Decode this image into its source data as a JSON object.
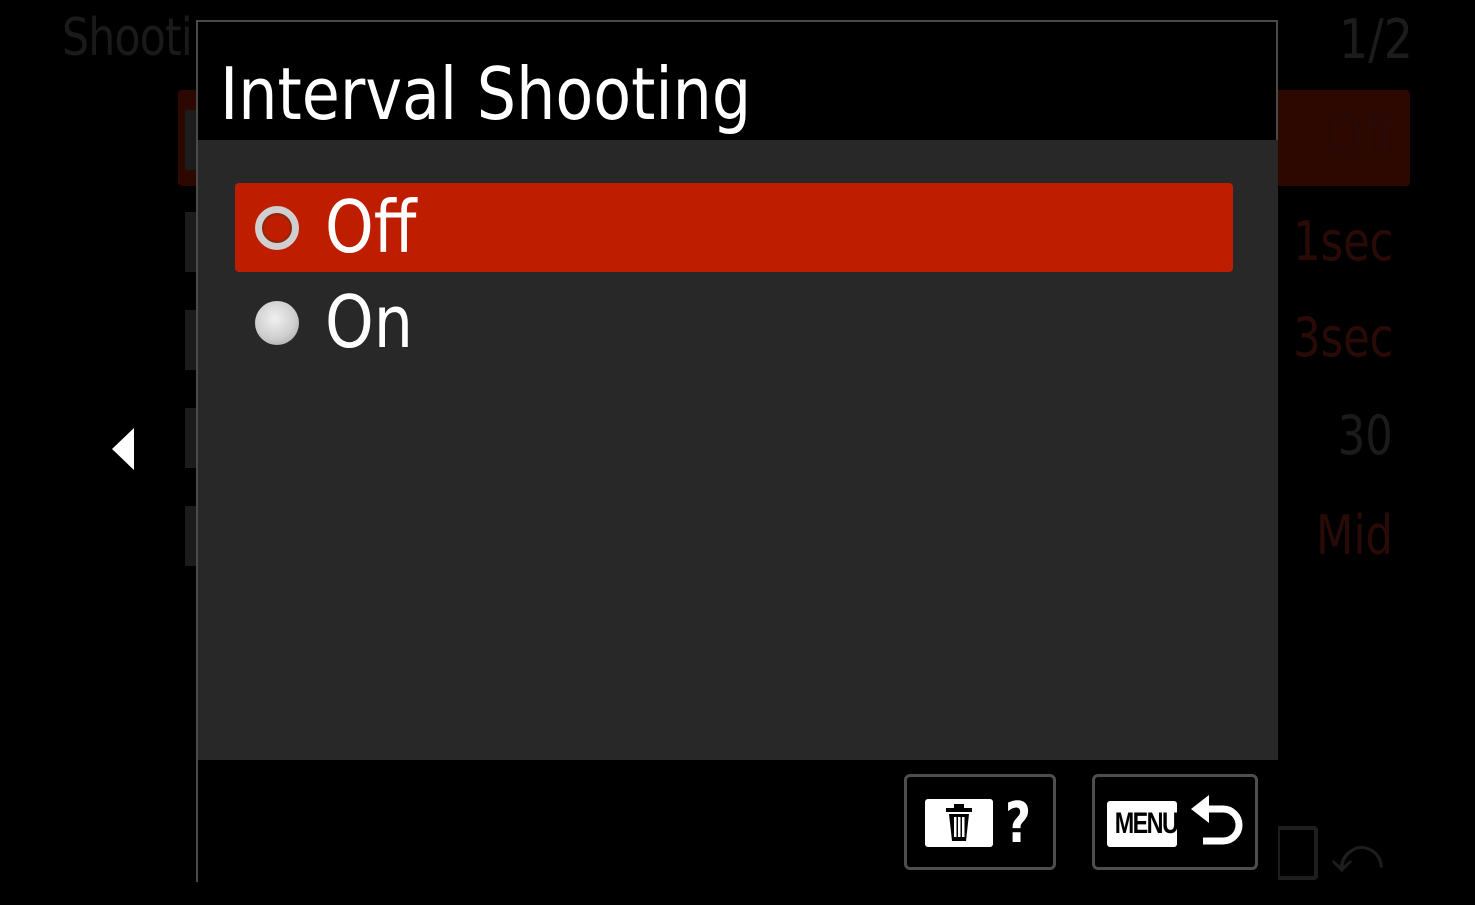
{
  "background_menu": {
    "title": "Shooti",
    "page_indicator": "1/2",
    "values": [
      "Off",
      "1sec",
      "3sec",
      "30",
      "Mid"
    ]
  },
  "dialog": {
    "title": "Interval Shooting",
    "options": [
      {
        "label": "Off",
        "selected": true
      },
      {
        "label": "On",
        "selected": false
      }
    ],
    "footer": {
      "delete_help_icon": "trash-help-icon",
      "help_glyph": "?",
      "menu_label": "MENU",
      "back_icon": "return-arrow-icon"
    }
  },
  "colors": {
    "selection": "#bf1d00",
    "body": "#282828",
    "frame": "#4a4a4a"
  }
}
